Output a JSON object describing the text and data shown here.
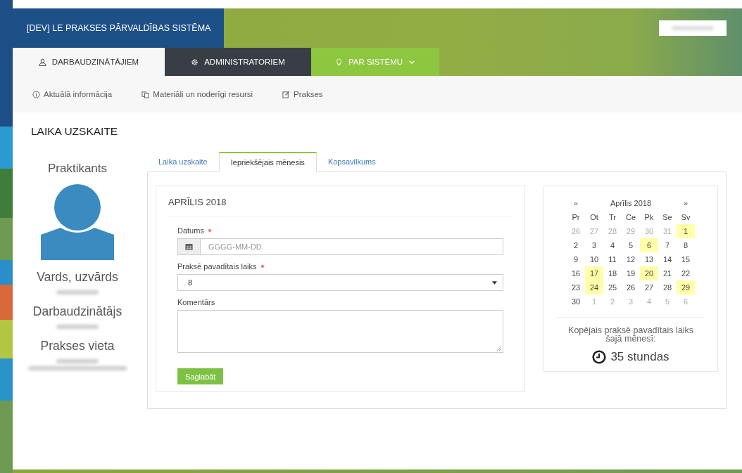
{
  "header": {
    "title": "[DEV] LE PRAKSES PĀRVALDĪBAS SISTĒMA"
  },
  "nav_tabs": [
    {
      "label": "DARBAUDZINĀTĀJIEM",
      "selected": true
    },
    {
      "label": "ADMINISTRATORIEM",
      "selected": false
    },
    {
      "label": "PAR SISTĒMU",
      "selected": false
    }
  ],
  "sub_nav": [
    {
      "label": "Aktuālā informācija"
    },
    {
      "label": "Materiāli un noderīgi resursi"
    },
    {
      "label": "Prakses"
    }
  ],
  "page_title": "LAIKA UZSKAITE",
  "profile": {
    "heading": "Praktikants",
    "fields": [
      {
        "label": "Vards, uzvārds"
      },
      {
        "label": "Darbaudzinātājs"
      },
      {
        "label": "Prakses vieta"
      }
    ]
  },
  "tabs": [
    {
      "label": "Laika uzskaite",
      "selected": false
    },
    {
      "label": "Iepriekšējais mēnesis",
      "selected": true
    },
    {
      "label": "Kopsavilkums",
      "selected": false
    }
  ],
  "form": {
    "title": "APRĪLIS 2018",
    "fields": [
      {
        "kind": "date",
        "label": "Datums",
        "required": true,
        "placeholder": "GGGG-MM-DD"
      },
      {
        "kind": "select",
        "label": "Praksē pavadītais laiks",
        "required": true,
        "value": "8"
      },
      {
        "kind": "textarea",
        "label": "Komentārs",
        "required": false
      }
    ],
    "button": "Saglabāt"
  },
  "calendar": {
    "prev": "«",
    "title": "Aprīlis 2018",
    "next": "»",
    "weekdays": [
      "Pr",
      "Ot",
      "Tr",
      "Ce",
      "Pk",
      "Se",
      "Sv"
    ],
    "weeks": [
      [
        {
          "d": "26",
          "muted": true,
          "marked": false
        },
        {
          "d": "27",
          "muted": true,
          "marked": false
        },
        {
          "d": "28",
          "muted": true,
          "marked": false
        },
        {
          "d": "29",
          "muted": true,
          "marked": false
        },
        {
          "d": "30",
          "muted": true,
          "marked": false
        },
        {
          "d": "31",
          "muted": true,
          "marked": false
        },
        {
          "d": "1",
          "muted": false,
          "marked": true
        }
      ],
      [
        {
          "d": "2",
          "muted": false,
          "marked": false
        },
        {
          "d": "3",
          "muted": false,
          "marked": false
        },
        {
          "d": "4",
          "muted": false,
          "marked": false
        },
        {
          "d": "5",
          "muted": false,
          "marked": false
        },
        {
          "d": "6",
          "muted": false,
          "marked": true
        },
        {
          "d": "7",
          "muted": false,
          "marked": false
        },
        {
          "d": "8",
          "muted": false,
          "marked": false
        }
      ],
      [
        {
          "d": "9",
          "muted": false,
          "marked": false
        },
        {
          "d": "10",
          "muted": false,
          "marked": false
        },
        {
          "d": "11",
          "muted": false,
          "marked": false
        },
        {
          "d": "12",
          "muted": false,
          "marked": false
        },
        {
          "d": "13",
          "muted": false,
          "marked": false
        },
        {
          "d": "14",
          "muted": false,
          "marked": false
        },
        {
          "d": "15",
          "muted": false,
          "marked": false
        }
      ],
      [
        {
          "d": "16",
          "muted": false,
          "marked": false
        },
        {
          "d": "17",
          "muted": false,
          "marked": true
        },
        {
          "d": "18",
          "muted": false,
          "marked": false
        },
        {
          "d": "19",
          "muted": false,
          "marked": false
        },
        {
          "d": "20",
          "muted": false,
          "marked": true
        },
        {
          "d": "21",
          "muted": false,
          "marked": false
        },
        {
          "d": "22",
          "muted": false,
          "marked": false
        }
      ],
      [
        {
          "d": "23",
          "muted": false,
          "marked": false
        },
        {
          "d": "24",
          "muted": false,
          "marked": true
        },
        {
          "d": "25",
          "muted": false,
          "marked": false
        },
        {
          "d": "26",
          "muted": false,
          "marked": false
        },
        {
          "d": "27",
          "muted": false,
          "marked": false
        },
        {
          "d": "28",
          "muted": false,
          "marked": false
        },
        {
          "d": "29",
          "muted": false,
          "marked": true
        }
      ],
      [
        {
          "d": "30",
          "muted": false,
          "marked": false
        },
        {
          "d": "1",
          "muted": true,
          "marked": false
        },
        {
          "d": "2",
          "muted": true,
          "marked": false
        },
        {
          "d": "3",
          "muted": true,
          "marked": false
        },
        {
          "d": "4",
          "muted": true,
          "marked": false
        },
        {
          "d": "5",
          "muted": true,
          "marked": false
        },
        {
          "d": "6",
          "muted": true,
          "marked": false
        }
      ]
    ],
    "total_label": "Kopējais praksē pavadītais laiks šajā mēnesī:",
    "total": "35 stundas"
  }
}
